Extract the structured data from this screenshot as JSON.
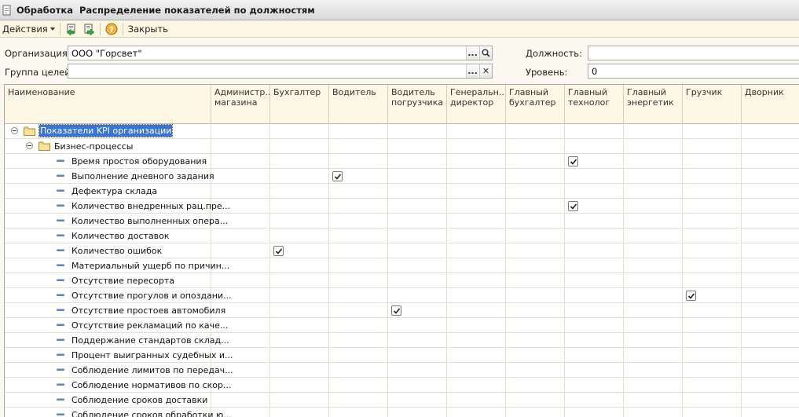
{
  "window": {
    "title": "Обработка  Распределение показателей по должностям"
  },
  "toolbar": {
    "actions_label": "Действия",
    "close_label": "Закрыть",
    "help_glyph": "?"
  },
  "filters": {
    "org_label": "Организация:",
    "org_value": "ООО \"Горсвет\"",
    "group_label": "Группа целей:",
    "group_value": "",
    "position_label": "Должность:",
    "position_value": "",
    "level_label": "Уровень:",
    "level_value": "0",
    "select_glyph": "...",
    "clear_glyph": "✕"
  },
  "grid": {
    "columns": [
      "Наименование",
      "Администр...\nмагазина",
      "Бухгалтер",
      "Водитель",
      "Водитель\nпогрузчика",
      "Генеральн...\nдиректор",
      "Главный\nбухгалтер",
      "Главный\nтехнолог",
      "Главный\nэнергетик",
      "Грузчик",
      "Дворник"
    ],
    "rows": [
      {
        "name": "Показатели KPI организации",
        "type": "group",
        "checked": []
      },
      {
        "name": "Бизнес-процессы",
        "type": "subgroup",
        "checked": []
      },
      {
        "name": "Время простоя оборудования",
        "type": "item",
        "checked": [
          7
        ]
      },
      {
        "name": "Выполнение дневного задания",
        "type": "item",
        "checked": [
          3
        ]
      },
      {
        "name": "Дефектура склада",
        "type": "item",
        "checked": []
      },
      {
        "name": "Количество внедренных рац.пре...",
        "type": "item",
        "checked": [
          7
        ]
      },
      {
        "name": "Количество выполненных опера...",
        "type": "item",
        "checked": []
      },
      {
        "name": "Количество доставок",
        "type": "item",
        "checked": []
      },
      {
        "name": "Количество ошибок",
        "type": "item",
        "checked": [
          2
        ]
      },
      {
        "name": "Материальный ущерб по причин...",
        "type": "item",
        "checked": []
      },
      {
        "name": "Отсутствие пересорта",
        "type": "item",
        "checked": []
      },
      {
        "name": "Отсутствие прогулов и опоздани...",
        "type": "item",
        "checked": [
          9
        ]
      },
      {
        "name": "Отсутствие простоев автомобиля",
        "type": "item",
        "checked": [
          4
        ]
      },
      {
        "name": "Отсутствие рекламаций по каче...",
        "type": "item",
        "checked": []
      },
      {
        "name": "Поддержание стандартов склад...",
        "type": "item",
        "checked": []
      },
      {
        "name": "Процент выигранных судебных и...",
        "type": "item",
        "checked": []
      },
      {
        "name": "Соблюдение лимитов по передач...",
        "type": "item",
        "checked": []
      },
      {
        "name": "Соблюдение нормативов по скор...",
        "type": "item",
        "checked": []
      },
      {
        "name": "Соблюдение сроков доставки",
        "type": "item",
        "checked": []
      },
      {
        "name": "Соблюдение сроков обработки ю...",
        "type": "item",
        "checked": []
      }
    ]
  },
  "colors": {
    "selection": "#3875d7",
    "panel": "#fbf7e4",
    "border": "#a9a9a9"
  }
}
